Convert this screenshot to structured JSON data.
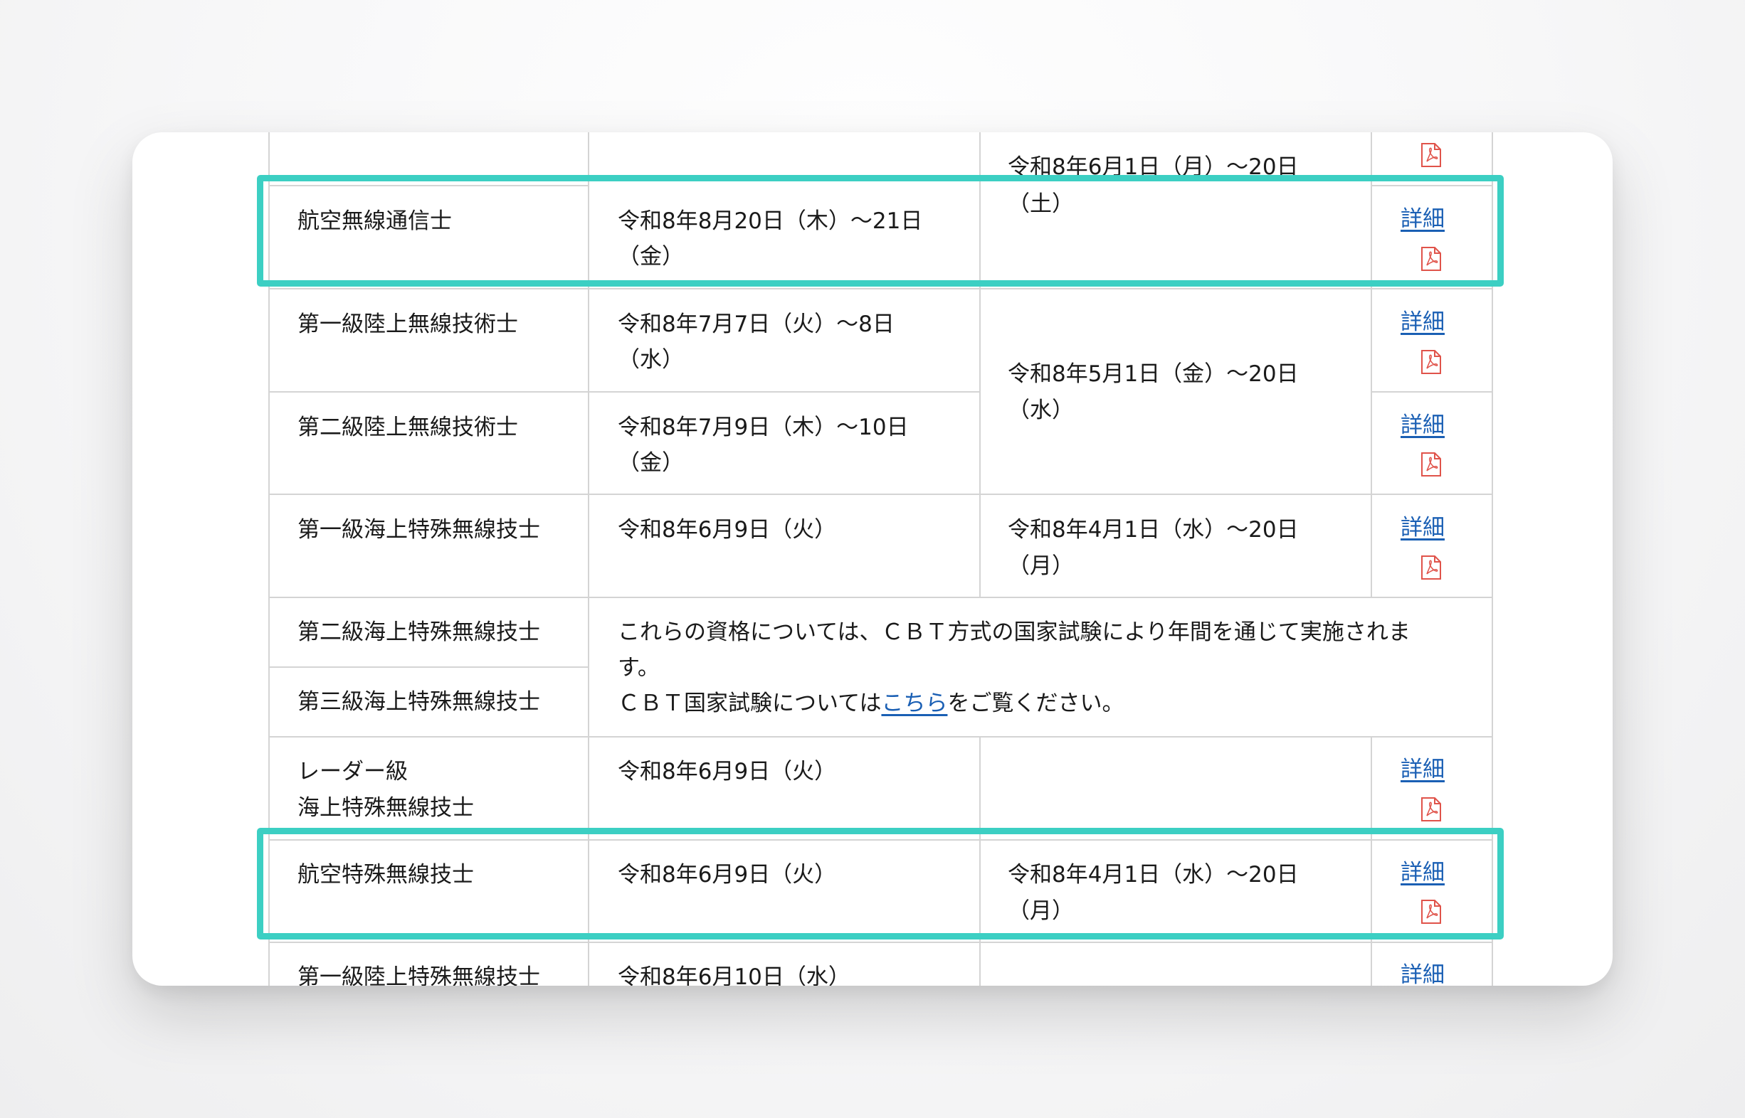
{
  "links": {
    "detail": "詳細",
    "pdf_icon": "pdf-icon"
  },
  "colors": {
    "highlight": "#3ccfc3",
    "link": "#1a5fb4",
    "pdf": "#e0534a",
    "border": "#d4d4d4"
  },
  "rows": {
    "r0": {
      "period": "令和8年6月1日（月）～20日",
      "period2": "（土）"
    },
    "r1": {
      "qual": "航空無線通信士",
      "date": "令和8年8月20日（木）～21日",
      "date2": "（金）"
    },
    "r2": {
      "qual": "第一級陸上無線技術士",
      "date": "令和8年7月7日（火）～8日",
      "date2": "（水）"
    },
    "r3": {
      "qual": "第二級陸上無線技術士",
      "date": "令和8年7月9日（木）～10日",
      "date2": "（金）"
    },
    "r23": {
      "period": "令和8年5月1日（金）～20日",
      "period2": "（水）"
    },
    "r4": {
      "qual": "第一級海上特殊無線技士",
      "date": "令和8年6月9日（火）",
      "period": "令和8年4月1日（水）～20日",
      "period2": "（月）"
    },
    "r5": {
      "qual": "第二級海上特殊無線技士"
    },
    "r6": {
      "qual": "第三級海上特殊無線技士"
    },
    "notice": {
      "line1": "これらの資格については、ＣＢＴ方式の国家試験により年間を通じて実施されま",
      "line2": "す。",
      "line3_pre": "ＣＢＴ国家試験については",
      "line3_link": "こちら",
      "line3_post": "をご覧ください。"
    },
    "r7": {
      "qual": "レーダー級",
      "qual2": "海上特殊無線技士",
      "date": "令和8年6月9日（火）"
    },
    "r8": {
      "qual": "航空特殊無線技士",
      "date": "令和8年6月9日（火）",
      "period": "令和8年4月1日（水）～20日",
      "period2": "（月）"
    },
    "r9": {
      "qual": "第一級陸上特殊無線技士",
      "date": "令和8年6月10日（水）"
    }
  }
}
